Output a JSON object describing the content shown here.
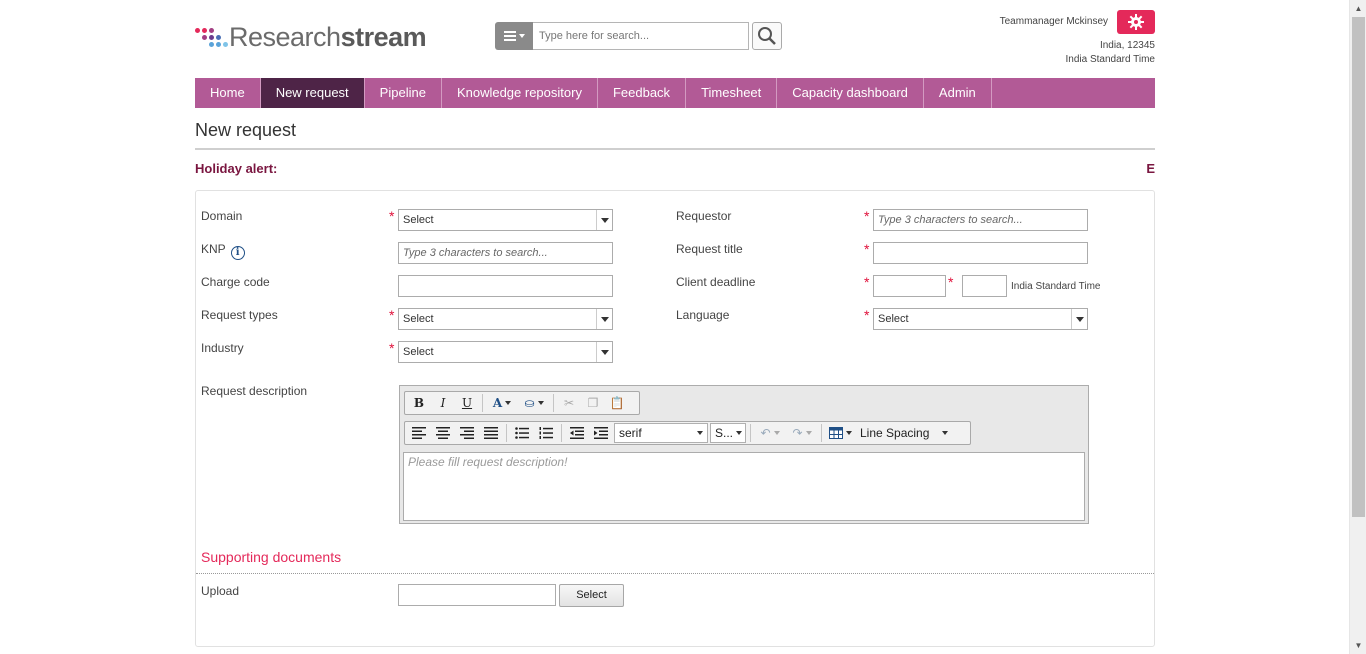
{
  "brand": {
    "name_regular": "Research",
    "name_bold": "stream"
  },
  "search": {
    "placeholder": "Type here for search..."
  },
  "user": {
    "name": "Teammanager Mckinsey",
    "location": "India, 12345",
    "timezone": "India Standard Time"
  },
  "nav": {
    "items": [
      {
        "label": "Home"
      },
      {
        "label": "New request"
      },
      {
        "label": "Pipeline"
      },
      {
        "label": "Knowledge repository"
      },
      {
        "label": "Feedback"
      },
      {
        "label": "Timesheet"
      },
      {
        "label": "Capacity dashboard"
      },
      {
        "label": "Admin"
      }
    ],
    "active": "New request"
  },
  "page": {
    "title": "New request",
    "holiday_label": "Holiday alert:",
    "holiday_tail": "E"
  },
  "form": {
    "domain": {
      "label": "Domain",
      "value": "Select"
    },
    "knp": {
      "label": "KNP",
      "placeholder": "Type 3 characters to search..."
    },
    "charge_code": {
      "label": "Charge code"
    },
    "request_types": {
      "label": "Request types",
      "value": "Select"
    },
    "industry": {
      "label": "Industry",
      "value": "Select"
    },
    "requestor": {
      "label": "Requestor",
      "placeholder": "Type 3 characters to search..."
    },
    "request_title": {
      "label": "Request title"
    },
    "client_deadline": {
      "label": "Client deadline",
      "timezone": "India Standard Time"
    },
    "language": {
      "label": "Language",
      "value": "Select"
    },
    "request_description": {
      "label": "Request description",
      "placeholder": "Please fill request description!"
    }
  },
  "editor": {
    "font": "serif",
    "size": "S...",
    "line_spacing": "Line Spacing"
  },
  "supporting": {
    "title": "Supporting documents",
    "upload_label": "Upload",
    "select_button": "Select"
  }
}
